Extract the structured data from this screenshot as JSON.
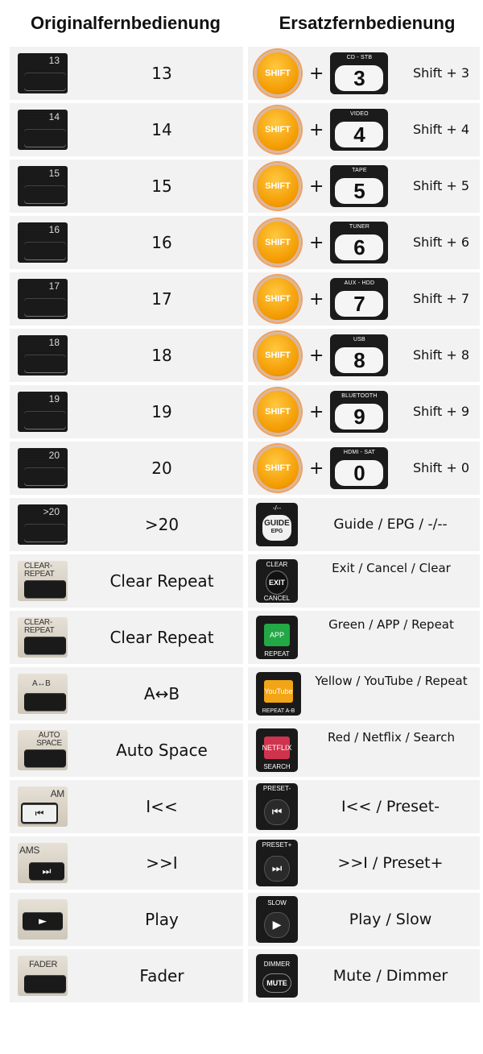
{
  "headers": {
    "original": "Originalfernbedienung",
    "replacement": "Ersatzfernbedienung"
  },
  "shift_rows": [
    {
      "orig_num": "13",
      "label": "13",
      "key_top": "CD - STB",
      "key_face": "3",
      "desc": "Shift + 3"
    },
    {
      "orig_num": "14",
      "label": "14",
      "key_top": "VIDEO",
      "key_face": "4",
      "desc": "Shift + 4"
    },
    {
      "orig_num": "15",
      "label": "15",
      "key_top": "TAPE",
      "key_face": "5",
      "desc": "Shift + 5"
    },
    {
      "orig_num": "16",
      "label": "16",
      "key_top": "TUNER",
      "key_face": "6",
      "desc": "Shift + 6"
    },
    {
      "orig_num": "17",
      "label": "17",
      "key_top": "AUX - HDD",
      "key_face": "7",
      "desc": "Shift + 7"
    },
    {
      "orig_num": "18",
      "label": "18",
      "key_top": "USB",
      "key_face": "8",
      "desc": "Shift + 8"
    },
    {
      "orig_num": "19",
      "label": "19",
      "key_top": "BLUETOOTH",
      "key_face": "9",
      "desc": "Shift + 9"
    },
    {
      "orig_num": "20",
      "label": "20",
      "key_top": "HDMI - SAT",
      "key_face": "0",
      "desc": "Shift + 0"
    }
  ],
  "shift_key_label": "SHIFT",
  "plus": "+",
  "rows": [
    {
      "orig_num": ">20",
      "label": ">20",
      "r_top": "-/--",
      "r_face": "GUIDE",
      "r_sub": "EPG",
      "desc": "Guide / EPG / -/--"
    },
    {
      "orig_num": "CLEAR- REPEAT",
      "label": "Clear Repeat",
      "r_top": "CLEAR",
      "r_face": "EXIT",
      "r_sub": "CANCEL",
      "desc": "Exit / Cancel / Clear"
    },
    {
      "orig_num": "CLEAR- REPEAT",
      "label": "Clear Repeat",
      "r_face": "APP",
      "r_sub": "REPEAT",
      "desc": "Green / APP / Repeat",
      "r_color": "#22a845"
    },
    {
      "orig_num": "A↔B",
      "label": "A↔B",
      "r_face": "YouTube",
      "r_sub": "REPEAT A-B",
      "desc": "Yellow / YouTube / Repeat",
      "r_color": "#f2a516"
    },
    {
      "orig_num": "AUTO SPACE",
      "label": "Auto Space",
      "r_face": "NETFLIX",
      "r_sub": "SEARCH",
      "desc": "Red / Netflix / Search",
      "r_color": "#d0334d"
    },
    {
      "orig_num": "AM",
      "label": "I<<",
      "r_top": "PRESET-",
      "r_face": "⏮",
      "desc": "I<< / Preset-"
    },
    {
      "orig_num": "AMS",
      "label": ">>I",
      "r_top": "PRESET+",
      "r_face": "⏭",
      "desc": ">>I / Preset+"
    },
    {
      "orig_num": "",
      "label": "Play",
      "r_top": "SLOW",
      "r_face": "▶",
      "desc": "Play / Slow"
    },
    {
      "orig_num": "FADER",
      "label": "Fader",
      "r_top": "DIMMER",
      "r_face": "MUTE",
      "desc": "Mute / Dimmer"
    }
  ],
  "glyphs": {
    "prev": "⏮",
    "next": "⏭",
    "play": "►"
  }
}
